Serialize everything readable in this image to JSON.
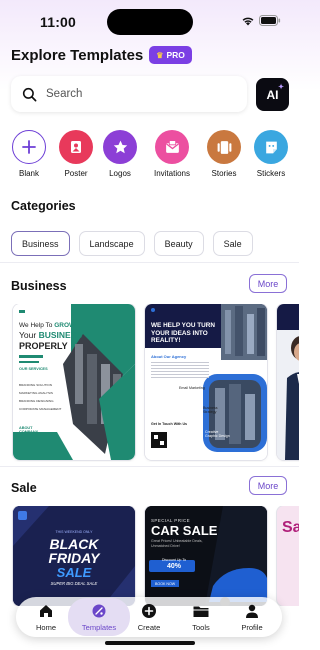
{
  "status": {
    "time": "11:00"
  },
  "header": {
    "title": "Explore Templates",
    "pro_label": "PRO"
  },
  "search": {
    "placeholder": "Search",
    "ai_label": "AI"
  },
  "quick_actions": [
    {
      "label": "Blank",
      "icon": "plus-icon",
      "color": "#ffffff"
    },
    {
      "label": "Poster",
      "icon": "poster-icon",
      "color": "#e8395b"
    },
    {
      "label": "Logos",
      "icon": "star-badge-icon",
      "color": "#8c3fd6"
    },
    {
      "label": "Invitations",
      "icon": "envelope-icon",
      "color": "#ec4fa0"
    },
    {
      "label": "Stories",
      "icon": "stories-icon",
      "color": "#c9783f"
    },
    {
      "label": "Stickers",
      "icon": "sticker-icon",
      "color": "#3aa7e0"
    }
  ],
  "categories": {
    "title": "Categories",
    "chips": [
      "Business",
      "Landscape",
      "Beauty",
      "Sale"
    ],
    "selected": "Business"
  },
  "business_section": {
    "title": "Business",
    "more_label": "More",
    "card1": {
      "headline_1": "We Help To",
      "headline_accent": "GROW",
      "headline_2": "Your",
      "headline_accent_2": "BUSINESS",
      "headline_3": "PROPERLY",
      "services_title": "OUR SERVICES",
      "services": [
        "BRANDING SOLUTION",
        "MARKETING ANALYSIS",
        "BRANDING DESIGNING",
        "CORPORATE MANAGEMENT"
      ],
      "about_title": "ABOUT COMPANY"
    },
    "card2": {
      "headline": "WE HELP YOU TURN YOUR IDEAS INTO REALITY!",
      "accent_phrase": "YOUR IDEAS",
      "agency_title": "About Our Agency",
      "features": [
        "Email Marketing",
        "Business Strategy",
        "Creative Graphic Design"
      ],
      "cta": "Get In Touch With Us"
    }
  },
  "sale_section": {
    "title": "Sale",
    "more_label": "More",
    "card1": {
      "top_line": "THIS WEEKEND ONLY",
      "line1": "BLACK",
      "line2": "FRIDAY",
      "line3": "SALE",
      "sub": "SUPER BIG DEAL SALE"
    },
    "card2": {
      "kicker": "SPECIAL PRICE",
      "headline": "CAR SALE",
      "sub": "Great Prices! Unbeatable Deals, Unmatched Drive!",
      "discount_label": "Discount Up To",
      "discount_value": "40%",
      "cta": "BOOK NOW"
    },
    "card3": {
      "text": "Sa"
    }
  },
  "tabbar": {
    "tabs": [
      {
        "label": "Home",
        "icon": "home-icon"
      },
      {
        "label": "Templates",
        "icon": "templates-icon"
      },
      {
        "label": "Create",
        "icon": "create-plus-icon"
      },
      {
        "label": "Tools",
        "icon": "folder-icon"
      },
      {
        "label": "Profile",
        "icon": "profile-icon"
      }
    ],
    "active": "Templates"
  },
  "colors": {
    "accent": "#7b3fe4",
    "teal": "#1f8a72",
    "navy": "#151a45",
    "blue": "#2d6fd6"
  }
}
